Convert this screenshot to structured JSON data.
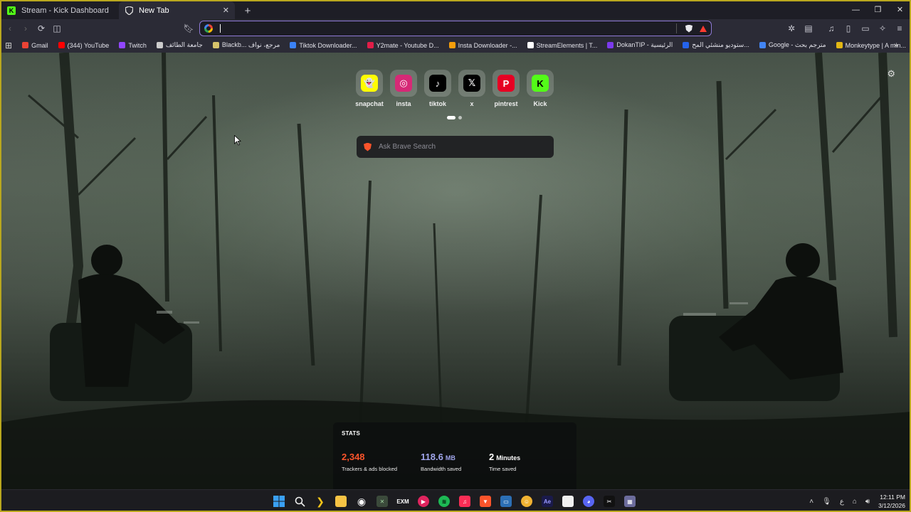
{
  "tabs": [
    {
      "title": "Stream - Kick Dashboard",
      "icon": "kick-icon",
      "active": false
    },
    {
      "title": "New Tab",
      "icon": "brave-shield-icon",
      "active": true
    }
  ],
  "address_bar": {
    "value": "",
    "placeholder": ""
  },
  "bookmarks": [
    {
      "label": "Gmail",
      "icon": "gmail-icon",
      "color": "#ea4335"
    },
    {
      "label": "(344) YouTube",
      "icon": "youtube-icon",
      "color": "#ff0000"
    },
    {
      "label": "Twitch",
      "icon": "twitch-icon",
      "color": "#9146ff"
    },
    {
      "label": "جامعة الطائف",
      "icon": "globe-icon",
      "color": "#cccccc"
    },
    {
      "label": "Blackb... مرجع، نواف",
      "icon": "tu-icon",
      "color": "#d6c36b"
    },
    {
      "label": "Tiktok Downloader...",
      "icon": "download-icon",
      "color": "#3b82f6"
    },
    {
      "label": "Y2mate - Youtube D...",
      "icon": "y2mate-icon",
      "color": "#e11d48"
    },
    {
      "label": "Insta Downloader -...",
      "icon": "insta-dl-icon",
      "color": "#f59e0b"
    },
    {
      "label": "StreamElements | T...",
      "icon": "streamelements-icon",
      "color": "#ffffff"
    },
    {
      "label": "DokanTIP - الرئيسية",
      "icon": "dokan-icon",
      "color": "#7c3aed"
    },
    {
      "label": "ستوديو منشئي المح...",
      "icon": "studio-icon",
      "color": "#2563eb"
    },
    {
      "label": "Google - مترجم بحث",
      "icon": "google-icon",
      "color": "#4285f4"
    },
    {
      "label": "Monkeytype | A min...",
      "icon": "monkeytype-icon",
      "color": "#e2b714"
    }
  ],
  "shortcuts": [
    {
      "label": "snapchat",
      "icon": "snapchat-icon",
      "bg": "#fffc00",
      "fg": "#000000",
      "glyph": "👻"
    },
    {
      "label": "insta",
      "icon": "instagram-icon",
      "bg": "#d62976",
      "fg": "#ffffff",
      "glyph": "◎"
    },
    {
      "label": "tiktok",
      "icon": "tiktok-icon",
      "bg": "#000000",
      "fg": "#ffffff",
      "glyph": "♪"
    },
    {
      "label": "x",
      "icon": "x-icon",
      "bg": "#000000",
      "fg": "#ffffff",
      "glyph": "𝕏"
    },
    {
      "label": "pintrest",
      "icon": "pinterest-icon",
      "bg": "#e60023",
      "fg": "#ffffff",
      "glyph": "P"
    },
    {
      "label": "Kick",
      "icon": "kick-icon",
      "bg": "#53fc18",
      "fg": "#000000",
      "glyph": "K"
    }
  ],
  "search": {
    "placeholder": "Ask Brave Search"
  },
  "stats": {
    "title": "STATS",
    "trackers": {
      "value": "2,348",
      "caption": "Trackers & ads blocked",
      "color": "#fb542b"
    },
    "bandwidth": {
      "value": "118.6",
      "unit": "MB",
      "caption": "Bandwidth saved",
      "color": "#a0a5eb"
    },
    "time": {
      "value": "2",
      "unit": "Minutes",
      "caption": "Time saved",
      "color": "#ffffff"
    }
  },
  "taskbar": {
    "clock_time": "12:11 PM",
    "clock_date": "3/12/2026",
    "ime": "ع"
  }
}
